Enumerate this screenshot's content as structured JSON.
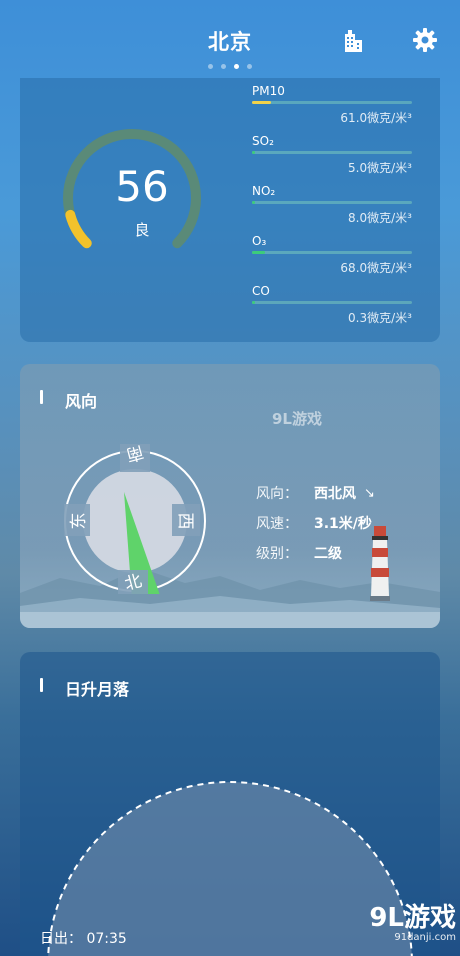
{
  "header": {
    "city": "北京",
    "page_indicator": {
      "count": 4,
      "active_index": 2
    }
  },
  "aqi": {
    "value": "56",
    "level": "良",
    "fraction": 0.11,
    "colors": {
      "track": "#5a8a78",
      "fill": "#f2c22c"
    },
    "pollutants": [
      {
        "name": "PM10",
        "value": "61.0微克/米³",
        "fraction": 0.12,
        "color": "#f2d24a"
      },
      {
        "name": "SO₂",
        "value": "5.0微克/米³",
        "fraction": 0.01,
        "color": "#3dcc7a"
      },
      {
        "name": "NO₂",
        "value": "8.0微克/米³",
        "fraction": 0.02,
        "color": "#3dcc7a"
      },
      {
        "name": "O₃",
        "value": "68.0微克/米³",
        "fraction": 0.08,
        "color": "#3dcc7a"
      },
      {
        "name": "CO",
        "value": "0.3微克/米³",
        "fraction": 0.01,
        "color": "#3dcc7a"
      }
    ]
  },
  "wind": {
    "title": "风向",
    "compass": {
      "south": "南",
      "west": "西",
      "north": "北",
      "east": "东"
    },
    "pointer_color": "#5fd36a",
    "rows": [
      {
        "label": "风向：",
        "value": "西北风"
      },
      {
        "label": "风速：",
        "value": "3.1米/秒"
      },
      {
        "label": "级别：",
        "value": "二级"
      }
    ],
    "watermark": "9L游戏"
  },
  "sun": {
    "title": "日升月落",
    "sunrise_label": "日出：",
    "sunrise_time": "07:35"
  },
  "brand": {
    "name": "9L游戏",
    "url": "91danji.com"
  }
}
